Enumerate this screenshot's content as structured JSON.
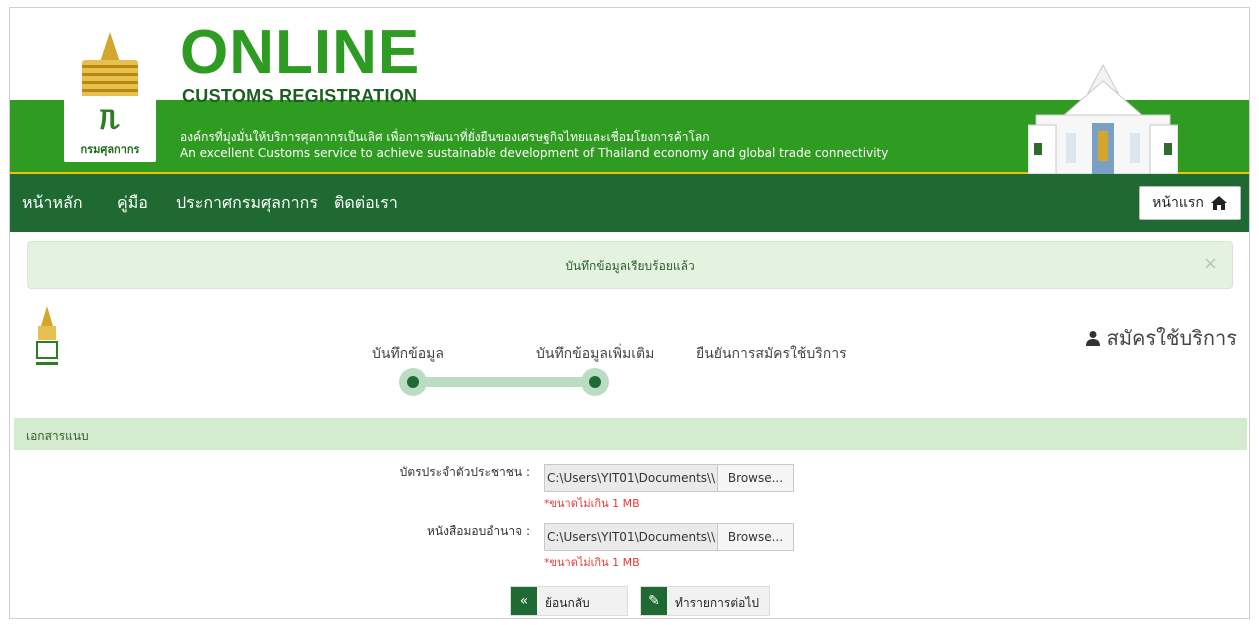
{
  "banner": {
    "logo_caption": "กรมศุลกากร",
    "title": "ONLINE",
    "subtitle": "CUSTOMS REGISTRATION",
    "tagline_th": "องค์กรที่มุ่งมั่นให้บริการศุลกากรเป็นเลิศ เพื่อการพัฒนาที่ยั่งยืนของเศรษฐกิจไทยและเชื่อมโยงการค้าโลก",
    "tagline_en": "An excellent Customs service to achieve sustainable development of Thailand economy and global trade connectivity"
  },
  "nav": {
    "items": [
      "หน้าหลัก",
      "คู่มือ",
      "ประกาศกรมศุลกากร",
      "ติดต่อเรา"
    ],
    "home_button": "หน้าแรก"
  },
  "alert": {
    "message": "บันทึกข้อมูลเรียบร้อยแล้ว",
    "close": "×"
  },
  "register": {
    "label": "สมัครใช้บริการ"
  },
  "steps": [
    {
      "label": "บันทึกข้อมูล",
      "done": true
    },
    {
      "label": "บันทึกข้อมูลเพิ่มเติม",
      "done": true
    },
    {
      "label": "ยืนยันการสมัครใช้บริการ",
      "done": false
    }
  ],
  "section": {
    "title": "เอกสารแนบ"
  },
  "fields": [
    {
      "label": "บัตรประจำตัวประชาชน :",
      "value": "C:\\Users\\YIT01\\Documents\\\\",
      "button": "Browse...",
      "hint": "*ขนาดไม่เกิน 1 MB"
    },
    {
      "label": "หนังสือมอบอำนาจ :",
      "value": "C:\\Users\\YIT01\\Documents\\\\",
      "button": "Browse...",
      "hint": "*ขนาดไม่เกิน 1 MB"
    }
  ],
  "buttons": {
    "back": "ย้อนกลับ",
    "next": "ทำรายการต่อไป"
  },
  "colors": {
    "brand_green": "#2f9b21",
    "nav_green": "#1e6a32",
    "alert_bg": "#e4f2e0",
    "hint_red": "#e53935"
  },
  "icons": [
    "home-icon",
    "user-icon",
    "close-icon",
    "double-chevron-left-icon",
    "edit-doc-icon"
  ]
}
